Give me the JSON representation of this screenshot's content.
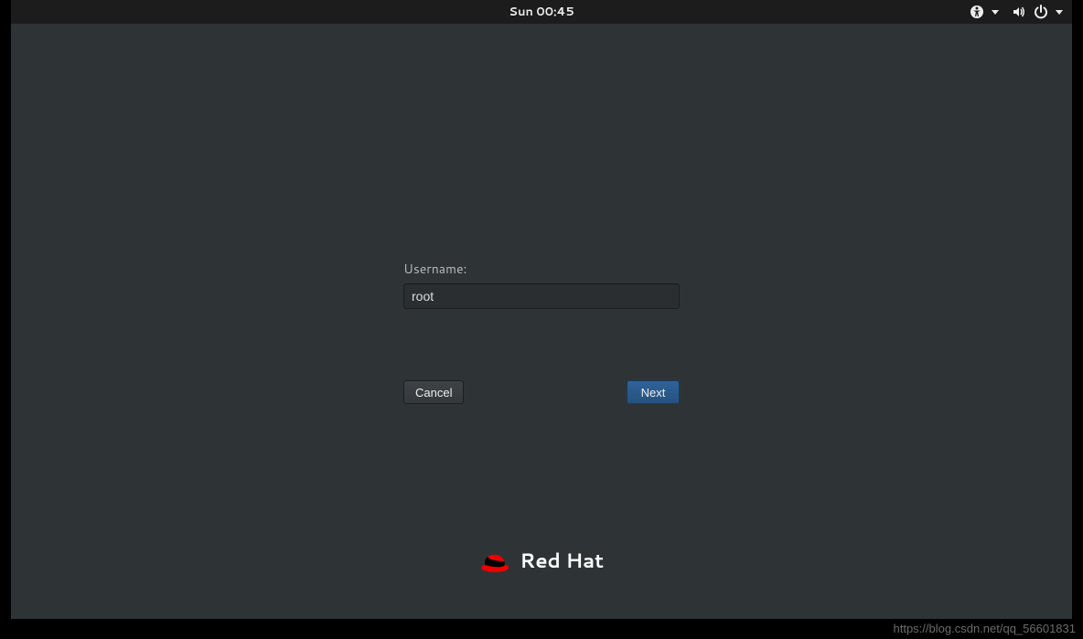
{
  "topbar": {
    "clock": "Sun 00:45"
  },
  "login": {
    "username_label": "Username:",
    "username_value": "root",
    "cancel_label": "Cancel",
    "next_label": "Next"
  },
  "brand": {
    "name": "Red Hat"
  },
  "watermark": "https://blog.csdn.net/qq_56601831"
}
